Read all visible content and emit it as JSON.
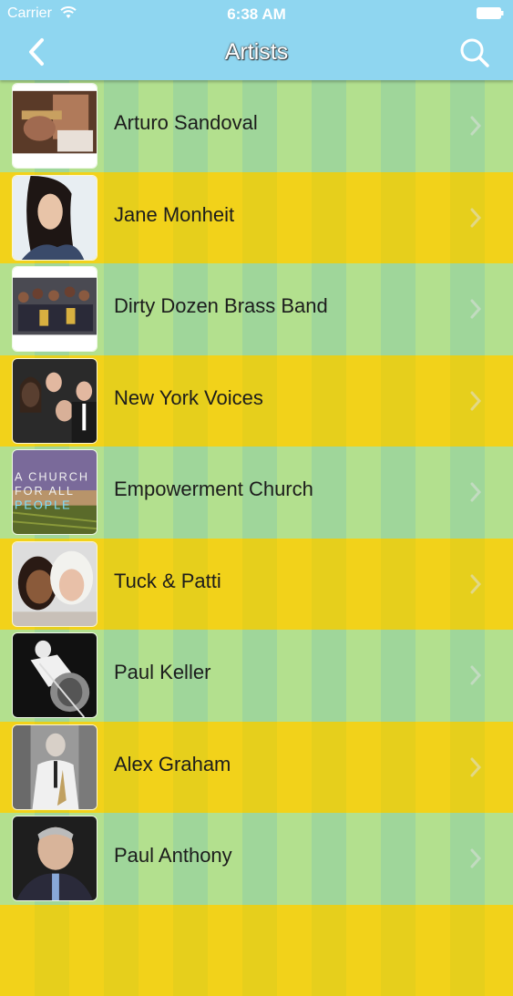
{
  "status_bar": {
    "carrier": "Carrier",
    "time": "6:38 AM"
  },
  "nav": {
    "title": "Artists",
    "back_icon": "chevron-left-icon",
    "search_icon": "search-icon"
  },
  "artists": [
    {
      "name": "Arturo Sandoval"
    },
    {
      "name": "Jane Monheit"
    },
    {
      "name": "Dirty Dozen Brass Band"
    },
    {
      "name": "New York Voices"
    },
    {
      "name": "Empowerment Church",
      "thumb_text": [
        "A CHURCH",
        "FOR ALL",
        "PEOPLE"
      ]
    },
    {
      "name": "Tuck & Patti"
    },
    {
      "name": "Paul Keller"
    },
    {
      "name": "Alex Graham"
    },
    {
      "name": "Paul Anthony"
    }
  ]
}
